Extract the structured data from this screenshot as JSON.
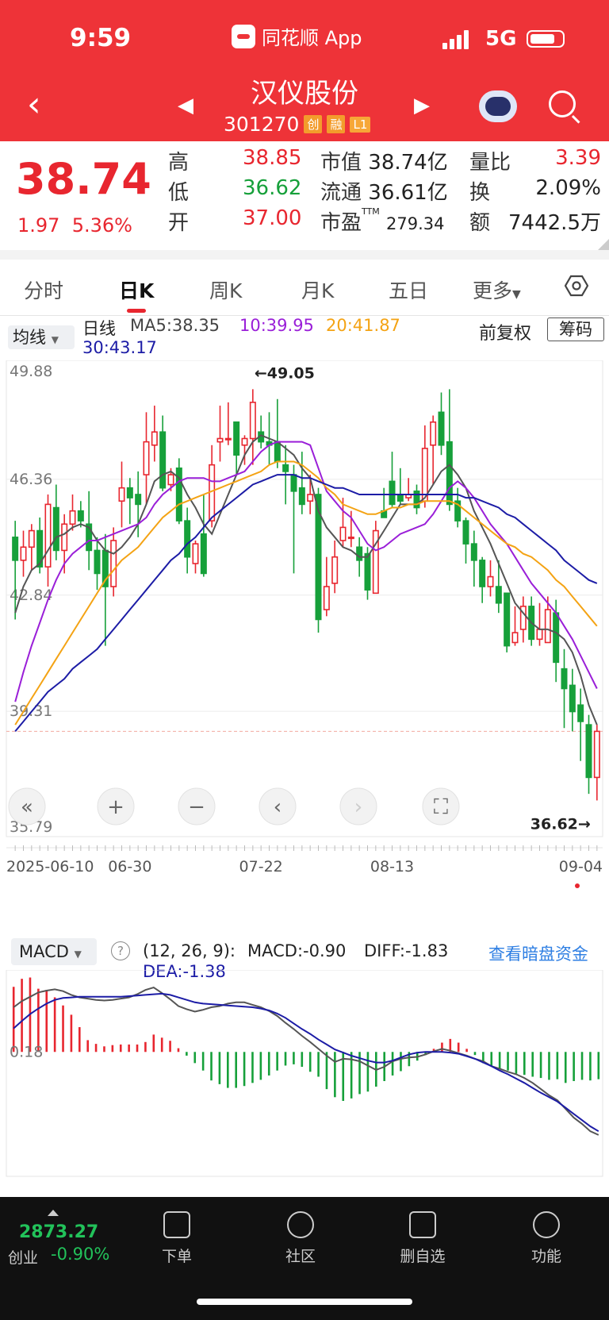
{
  "status": {
    "time": "9:59",
    "app_name": "同花顺 App",
    "network": "5G"
  },
  "header": {
    "title": "汉仪股份",
    "code": "301270",
    "tags": [
      "创",
      "融",
      "L1"
    ]
  },
  "quote": {
    "price": "38.74",
    "change": "1.97",
    "change_pct": "5.36%",
    "stats": [
      {
        "label": "高",
        "value": "38.85",
        "color": "red"
      },
      {
        "label": "低",
        "value": "36.62",
        "color": "green"
      },
      {
        "label": "开",
        "value": "37.00",
        "color": "red"
      }
    ],
    "mid": [
      {
        "label": "市值",
        "value": "38.74亿"
      },
      {
        "label": "流通",
        "value": "36.61亿"
      },
      {
        "label": "市盈",
        "sup": "TTM",
        "value": "279.34"
      }
    ],
    "right": [
      {
        "label": "量比",
        "value": "3.39",
        "color": "red"
      },
      {
        "label": "换",
        "value": "2.09%"
      },
      {
        "label": "额",
        "value": "7442.5万"
      }
    ]
  },
  "tabs": [
    "分时",
    "日K",
    "周K",
    "月K",
    "五日",
    "更多"
  ],
  "active_tab": "日K",
  "ma_bar": {
    "button": "均线",
    "period": "日线",
    "ma5": "MA5:38.35",
    "ma10": "10:39.95",
    "ma20": "20:41.87",
    "ma30": "30:43.17",
    "adjust": "前复权",
    "chip": "筹码"
  },
  "chart_data": [
    {
      "type": "candlestick",
      "y_ticks": [
        "49.88",
        "46.36",
        "42.84",
        "39.31",
        "35.79"
      ],
      "ylim": [
        35.79,
        49.88
      ],
      "x_labels": [
        "2025-06-10",
        "06-30",
        "07-22",
        "08-13",
        "09-04"
      ],
      "x_label_index": [
        0,
        14,
        30,
        46,
        62
      ],
      "max_annotation": "←49.05",
      "min_annotation": "36.62→",
      "candles": [
        [
          44.6,
          43.9,
          45.1,
          42.1
        ],
        [
          43.9,
          44.3,
          44.8,
          43.4
        ],
        [
          44.3,
          44.8,
          45.0,
          43.6
        ],
        [
          44.8,
          43.7,
          45.2,
          43.5
        ],
        [
          43.7,
          45.6,
          45.9,
          43.1
        ],
        [
          45.5,
          44.2,
          46.2,
          43.9
        ],
        [
          44.2,
          45.0,
          45.3,
          43.5
        ],
        [
          45.0,
          45.4,
          45.9,
          44.8
        ],
        [
          45.4,
          45.1,
          45.7,
          44.9
        ],
        [
          45.0,
          44.2,
          46.0,
          43.6
        ],
        [
          44.2,
          43.5,
          44.6,
          43.0
        ],
        [
          44.2,
          43.1,
          44.7,
          41.3
        ],
        [
          43.1,
          44.5,
          44.9,
          42.8
        ],
        [
          45.7,
          46.1,
          46.9,
          44.9
        ],
        [
          46.1,
          45.8,
          46.4,
          45.0
        ],
        [
          45.9,
          45.6,
          46.6,
          44.6
        ],
        [
          46.5,
          47.5,
          48.4,
          45.6
        ],
        [
          47.4,
          47.8,
          48.6,
          46.9
        ],
        [
          47.8,
          46.1,
          48.3,
          46.0
        ],
        [
          46.2,
          46.5,
          46.7,
          46.0
        ],
        [
          46.7,
          45.1,
          47.0,
          45.0
        ],
        [
          45.1,
          44.0,
          45.5,
          43.5
        ],
        [
          43.8,
          44.4,
          44.5,
          43.5
        ],
        [
          44.7,
          43.5,
          45.9,
          43.4
        ],
        [
          45.1,
          46.8,
          47.4,
          44.9
        ],
        [
          47.5,
          47.6,
          48.6,
          46.9
        ],
        [
          47.6,
          47.6,
          48.7,
          47.4
        ],
        [
          48.1,
          47.1,
          48.1,
          46.5
        ],
        [
          47.4,
          47.6,
          47.7,
          46.8
        ],
        [
          47.6,
          48.7,
          49.1,
          46.8
        ],
        [
          47.8,
          47.5,
          48.3,
          47.3
        ],
        [
          47.5,
          47.4,
          48.4,
          46.8
        ],
        [
          47.5,
          46.9,
          48.8,
          46.7
        ],
        [
          46.8,
          46.6,
          47.4,
          45.6
        ],
        [
          46.5,
          46.0,
          46.8,
          43.5
        ],
        [
          46.1,
          45.6,
          47.2,
          45.3
        ],
        [
          45.7,
          45.9,
          46.5,
          45.3
        ],
        [
          45.9,
          42.1,
          46.1,
          41.7
        ],
        [
          42.4,
          43.1,
          44.0,
          42.2
        ],
        [
          43.2,
          44.0,
          44.5,
          42.9
        ],
        [
          44.5,
          44.9,
          45.8,
          44.3
        ],
        [
          44.6,
          44.6,
          45.4,
          44.3
        ],
        [
          44.3,
          43.9,
          44.6,
          43.4
        ],
        [
          44.1,
          43.0,
          44.3,
          42.7
        ],
        [
          42.9,
          44.8,
          45.1,
          42.9
        ],
        [
          45.4,
          45.2,
          46.1,
          45.2
        ],
        [
          46.3,
          45.6,
          47.2,
          45.5
        ],
        [
          45.9,
          45.7,
          46.7,
          45.6
        ],
        [
          45.8,
          45.9,
          46.4,
          45.7
        ],
        [
          46.0,
          45.5,
          46.2,
          45.3
        ],
        [
          45.7,
          47.3,
          48.0,
          45.5
        ],
        [
          47.4,
          48.1,
          48.3,
          46.2
        ],
        [
          48.4,
          47.4,
          49.0,
          47.1
        ],
        [
          47.5,
          45.6,
          49.1,
          45.4
        ],
        [
          45.7,
          45.1,
          46.1,
          44.9
        ],
        [
          45.1,
          44.4,
          45.2,
          43.8
        ],
        [
          44.4,
          43.9,
          44.8,
          43.1
        ],
        [
          43.9,
          43.1,
          44.0,
          42.6
        ],
        [
          43.1,
          43.4,
          43.9,
          42.8
        ],
        [
          43.1,
          42.6,
          43.9,
          42.3
        ],
        [
          42.9,
          41.3,
          42.9,
          41.1
        ],
        [
          41.4,
          41.7,
          42.5,
          41.3
        ],
        [
          41.8,
          42.5,
          42.8,
          41.4
        ],
        [
          42.5,
          41.5,
          42.8,
          41.3
        ],
        [
          41.5,
          41.8,
          42.6,
          41.3
        ],
        [
          41.4,
          42.4,
          42.8,
          41.4
        ],
        [
          42.3,
          40.8,
          42.7,
          40.2
        ],
        [
          40.6,
          40.0,
          41.2,
          38.8
        ],
        [
          40.1,
          39.3,
          40.6,
          38.7
        ],
        [
          39.5,
          39.0,
          40.0,
          37.8
        ],
        [
          38.9,
          37.3,
          39.2,
          36.8
        ],
        [
          37.3,
          38.7,
          38.9,
          36.6
        ]
      ],
      "series": [
        {
          "name": "MA5",
          "color": "#555555",
          "values": [
            42.3,
            43.1,
            43.6,
            43.8,
            44.2,
            44.6,
            44.7,
            44.9,
            45.0,
            44.9,
            44.5,
            44.2,
            44.1,
            44.3,
            44.6,
            45.0,
            45.6,
            46.3,
            46.5,
            46.6,
            46.4,
            45.9,
            45.5,
            45.0,
            44.7,
            45.3,
            45.9,
            46.5,
            47.1,
            47.5,
            47.7,
            47.6,
            47.5,
            47.3,
            47.1,
            46.7,
            46.4,
            45.4,
            44.9,
            44.6,
            44.3,
            44.2,
            44.0,
            44.0,
            44.4,
            44.8,
            45.2,
            45.6,
            45.6,
            45.6,
            45.8,
            46.2,
            46.6,
            46.8,
            46.5,
            46.1,
            45.4,
            44.9,
            44.4,
            43.8,
            43.2,
            42.6,
            42.3,
            42.0,
            41.8,
            41.8,
            41.7,
            41.5,
            41.1,
            40.4,
            39.5,
            38.9
          ]
        },
        {
          "name": "MA10",
          "color": "#9a1fd8",
          "values": [
            39.6,
            40.5,
            41.3,
            42.0,
            42.7,
            43.3,
            43.8,
            44.1,
            44.3,
            44.5,
            44.5,
            44.6,
            44.7,
            44.8,
            44.9,
            45.0,
            45.2,
            45.6,
            45.9,
            46.1,
            46.3,
            46.4,
            46.4,
            46.4,
            46.3,
            46.3,
            46.4,
            46.5,
            46.6,
            46.9,
            47.2,
            47.4,
            47.5,
            47.5,
            47.5,
            47.5,
            47.4,
            46.7,
            46.0,
            45.7,
            45.4,
            45.2,
            44.8,
            44.4,
            44.2,
            44.3,
            44.5,
            44.7,
            44.8,
            44.9,
            45.0,
            45.3,
            45.7,
            46.1,
            46.3,
            46.1,
            45.8,
            45.4,
            45.0,
            44.7,
            44.4,
            44.0,
            43.6,
            43.2,
            42.9,
            42.6,
            42.3,
            41.9,
            41.5,
            41.0,
            40.5,
            40.0
          ]
        },
        {
          "name": "MA20",
          "color": "#f4a314",
          "values": [
            38.9,
            39.3,
            39.7,
            40.1,
            40.5,
            40.9,
            41.3,
            41.7,
            42.1,
            42.5,
            42.9,
            43.3,
            43.6,
            43.9,
            44.1,
            44.3,
            44.6,
            44.9,
            45.2,
            45.4,
            45.6,
            45.7,
            45.8,
            45.9,
            46.0,
            46.1,
            46.2,
            46.3,
            46.4,
            46.5,
            46.6,
            46.8,
            46.9,
            46.9,
            46.9,
            46.8,
            46.6,
            46.4,
            46.1,
            45.9,
            45.6,
            45.5,
            45.4,
            45.3,
            45.3,
            45.4,
            45.5,
            45.5,
            45.6,
            45.6,
            45.7,
            45.7,
            45.7,
            45.7,
            45.6,
            45.4,
            45.2,
            45.0,
            44.8,
            44.6,
            44.4,
            44.3,
            44.1,
            44.0,
            43.8,
            43.6,
            43.3,
            43.1,
            42.8,
            42.5,
            42.2,
            41.9
          ]
        },
        {
          "name": "MA30",
          "color": "#1c1ca6",
          "values": [
            38.7,
            39.0,
            39.3,
            39.6,
            39.9,
            40.1,
            40.3,
            40.6,
            40.8,
            41.0,
            41.2,
            41.5,
            41.8,
            42.1,
            42.4,
            42.7,
            43.0,
            43.3,
            43.6,
            43.9,
            44.1,
            44.4,
            44.6,
            44.9,
            45.2,
            45.4,
            45.6,
            45.8,
            46.0,
            46.2,
            46.3,
            46.4,
            46.5,
            46.5,
            46.5,
            46.4,
            46.4,
            46.3,
            46.2,
            46.1,
            46.1,
            46.0,
            45.9,
            45.9,
            45.9,
            45.9,
            45.9,
            45.9,
            45.9,
            45.9,
            45.9,
            45.9,
            45.9,
            45.9,
            45.9,
            45.8,
            45.8,
            45.7,
            45.6,
            45.5,
            45.3,
            45.2,
            45.0,
            44.8,
            44.6,
            44.4,
            44.2,
            43.9,
            43.7,
            43.5,
            43.3,
            43.2
          ]
        }
      ],
      "controls": [
        "«",
        "+",
        "−",
        "‹",
        "›",
        "⛶"
      ]
    },
    {
      "type": "bar+line",
      "name": "MACD",
      "params": "(12, 26, 9):",
      "macd_label": "MACD:-0.90",
      "diff_label": "DIFF:-1.83",
      "dea_label": "DEA:-1.38",
      "link": "查看暗盘资金",
      "zero_tick": "0.18",
      "ylim": [
        -1.75,
        1.4
      ],
      "zero": 0.18,
      "histogram": [
        1.05,
        1.18,
        1.2,
        1.02,
        1.0,
        0.88,
        0.75,
        0.6,
        0.4,
        0.19,
        0.13,
        0.09,
        0.11,
        0.12,
        0.12,
        0.12,
        0.16,
        0.28,
        0.23,
        0.18,
        0.06,
        -0.06,
        -0.18,
        -0.3,
        -0.46,
        -0.52,
        -0.58,
        -0.58,
        -0.55,
        -0.5,
        -0.45,
        -0.38,
        -0.3,
        -0.22,
        -0.2,
        -0.24,
        -0.32,
        -0.4,
        -0.6,
        -0.73,
        -0.79,
        -0.75,
        -0.68,
        -0.64,
        -0.56,
        -0.47,
        -0.38,
        -0.31,
        -0.23,
        -0.14,
        -0.05,
        0.05,
        0.15,
        0.21,
        0.15,
        0.05,
        -0.05,
        -0.18,
        -0.23,
        -0.27,
        -0.3,
        -0.35,
        -0.37,
        -0.4,
        -0.42,
        -0.45,
        -0.44,
        -0.5,
        -0.47,
        -0.45,
        -0.46,
        -0.44
      ],
      "series": [
        {
          "name": "DIFF",
          "color": "#555555",
          "values": [
            0.9,
            1.0,
            1.07,
            1.14,
            1.17,
            1.19,
            1.16,
            1.1,
            1.06,
            1.04,
            1.02,
            1.01,
            1.02,
            1.04,
            1.06,
            1.11,
            1.18,
            1.22,
            1.13,
            1.03,
            0.92,
            0.87,
            0.83,
            0.86,
            0.9,
            0.92,
            0.96,
            0.98,
            0.98,
            0.94,
            0.9,
            0.84,
            0.76,
            0.65,
            0.55,
            0.44,
            0.34,
            0.23,
            0.12,
            0.02,
            0.07,
            0.06,
            0.03,
            -0.04,
            -0.11,
            -0.06,
            0.03,
            0.07,
            0.09,
            0.1,
            0.14,
            0.19,
            0.23,
            0.2,
            0.16,
            0.12,
            0.07,
            0.03,
            -0.05,
            -0.09,
            -0.14,
            -0.18,
            -0.24,
            -0.32,
            -0.42,
            -0.52,
            -0.6,
            -0.74,
            -0.88,
            -0.98,
            -1.1,
            -1.16
          ]
        },
        {
          "name": "DEA",
          "color": "#1c1ca6",
          "values": [
            0.56,
            0.68,
            0.79,
            0.88,
            0.96,
            1.02,
            1.05,
            1.06,
            1.07,
            1.07,
            1.07,
            1.07,
            1.07,
            1.07,
            1.08,
            1.09,
            1.1,
            1.11,
            1.12,
            1.1,
            1.06,
            1.02,
            0.98,
            0.96,
            0.95,
            0.94,
            0.93,
            0.92,
            0.91,
            0.9,
            0.88,
            0.85,
            0.8,
            0.73,
            0.64,
            0.55,
            0.47,
            0.38,
            0.3,
            0.22,
            0.17,
            0.12,
            0.08,
            0.04,
            0.01,
            0.01,
            0.04,
            0.09,
            0.14,
            0.17,
            0.18,
            0.18,
            0.18,
            0.17,
            0.15,
            0.11,
            0.07,
            0.01,
            -0.05,
            -0.12,
            -0.18,
            -0.25,
            -0.32,
            -0.4,
            -0.48,
            -0.55,
            -0.62,
            -0.72,
            -0.82,
            -0.92,
            -1.02,
            -1.1
          ]
        }
      ]
    }
  ],
  "footer": {
    "index_value": "2873.27",
    "index_name": "创业",
    "index_change": "-0.90%",
    "buttons": [
      "下单",
      "社区",
      "删自选",
      "功能"
    ]
  },
  "colors": {
    "brand": "#ee3338",
    "up": "#e8262f",
    "down": "#16a03a",
    "link": "#2f7fe3"
  }
}
